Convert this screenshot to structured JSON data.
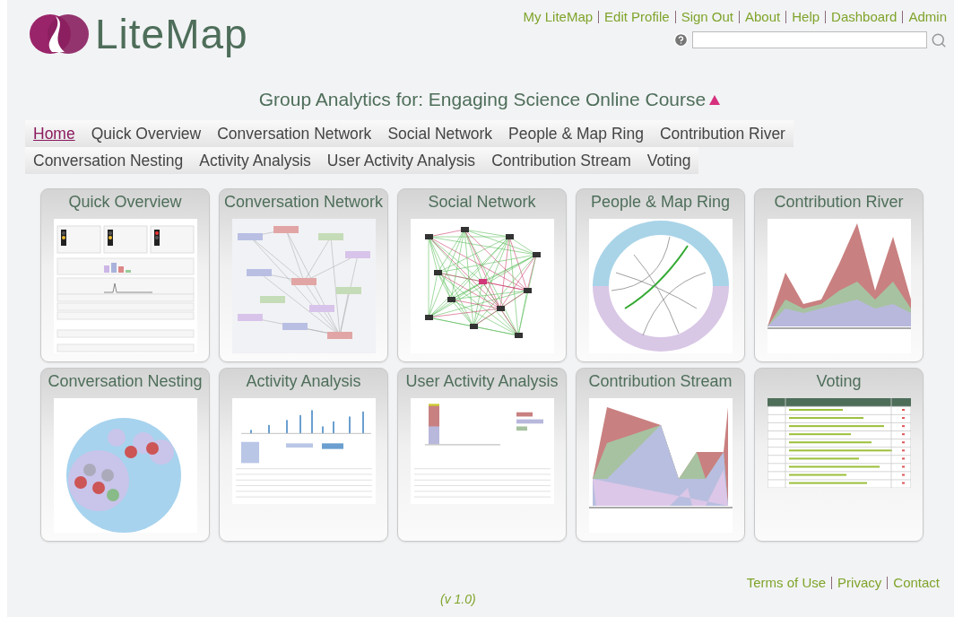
{
  "header": {
    "logo": "LiteMap",
    "links": [
      {
        "label": "My LiteMap"
      },
      {
        "label": "Edit Profile"
      },
      {
        "label": "Sign Out"
      },
      {
        "label": "About"
      },
      {
        "label": "Help"
      },
      {
        "label": "Dashboard"
      },
      {
        "label": "Admin"
      }
    ]
  },
  "title": {
    "text": "Group Analytics for: Engaging Science Online Course"
  },
  "nav": [
    {
      "label": "Home",
      "selected": true
    },
    {
      "label": "Quick Overview",
      "selected": false
    },
    {
      "label": "Conversation Network",
      "selected": false
    },
    {
      "label": "Social Network",
      "selected": false
    },
    {
      "label": "People & Map Ring",
      "selected": false
    },
    {
      "label": "Contribution River",
      "selected": false
    },
    {
      "label": "Conversation Nesting",
      "selected": false
    },
    {
      "label": "Activity Analysis",
      "selected": false
    },
    {
      "label": "User Activity Analysis",
      "selected": false
    },
    {
      "label": "Contribution Stream",
      "selected": false
    },
    {
      "label": "Voting",
      "selected": false
    }
  ],
  "cards": [
    {
      "title": "Quick Overview",
      "kind": "dashboard"
    },
    {
      "title": "Conversation Network",
      "kind": "network"
    },
    {
      "title": "Social Network",
      "kind": "social"
    },
    {
      "title": "People & Map Ring",
      "kind": "ring"
    },
    {
      "title": "Contribution River",
      "kind": "river"
    },
    {
      "title": "Conversation Nesting",
      "kind": "nesting"
    },
    {
      "title": "Activity Analysis",
      "kind": "activity"
    },
    {
      "title": "User Activity Analysis",
      "kind": "useractivity"
    },
    {
      "title": "Contribution Stream",
      "kind": "stream"
    },
    {
      "title": "Voting",
      "kind": "table"
    }
  ],
  "footer": {
    "links": [
      {
        "label": "Terms of Use"
      },
      {
        "label": "Privacy"
      },
      {
        "label": "Contact"
      }
    ],
    "version": "(v 1.0)"
  }
}
